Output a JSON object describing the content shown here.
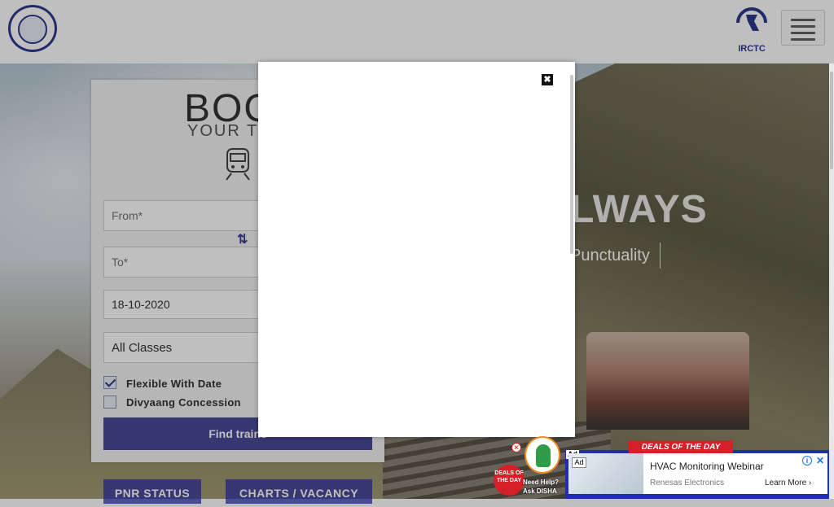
{
  "header": {
    "logo_left": "Indian Railways",
    "logo_right_text": "IRCTC"
  },
  "hero": {
    "title": "LWAYS",
    "subtitle": "Punctuality"
  },
  "booking": {
    "title": "BOO",
    "subtitle": "YOUR TIC",
    "from_placeholder": "From*",
    "to_placeholder": "To*",
    "date_value": "18-10-2020",
    "class_value": "All Classes",
    "flexible_label": "Flexible With Date",
    "flexible_checked": true,
    "divyaang_label": "Divyaang Concession",
    "divyaang_checked": false,
    "find_button": "Find trains",
    "pnr_button": "PNR STATUS",
    "charts_button": "CHARTS / VACANCY"
  },
  "modal": {
    "close_icon": "✖"
  },
  "disha": {
    "deals_badge": "DEALS OF THE DAY",
    "help_line1": "Need Help?",
    "help_line2": "Ask DISHA"
  },
  "ad": {
    "tag": "Ad",
    "ribbon": "DEALS OF THE DAY",
    "image_tag": "Ad",
    "title": "HVAC Monitoring Webinar",
    "sponsor": "Renesas Electronics",
    "cta": "Learn More",
    "colors": {
      "background": "#1f2fa8",
      "ribbon": "#d61f26"
    }
  }
}
